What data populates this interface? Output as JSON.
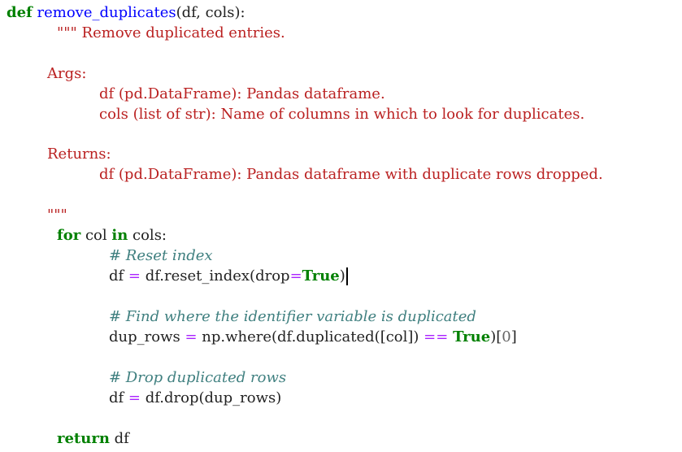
{
  "code": {
    "def_kw": "def",
    "func_name": "remove_duplicates",
    "signature": "(df, cols):",
    "doc_open": "\"\"\" Remove duplicated entries.",
    "args_header": "Args:",
    "arg_df": "df (pd.DataFrame): Pandas dataframe.",
    "arg_cols": "cols (list of str): Name of columns in which to look for duplicates.",
    "returns_header": "Returns:",
    "ret_df": "df (pd.DataFrame): Pandas dataframe with duplicate rows dropped.",
    "doc_close": "\"\"\"",
    "for_kw": "for",
    "for_var": " col ",
    "in_kw": "in",
    "for_iter": " cols:",
    "comment_reset": "# Reset index",
    "reset_lhs": "df ",
    "reset_eq": "=",
    "reset_rhs": " df.reset_index(drop",
    "reset_eq2": "=",
    "true1": "True",
    "reset_close": ")",
    "comment_find": "# Find where the identifier variable is duplicated",
    "dup_lhs": "dup_rows ",
    "dup_eq": "=",
    "dup_rhs": " np.where(df.duplicated([col]) ",
    "dup_cmp": "==",
    "true2": "True",
    "dup_close": ")[",
    "dup_idx": "0",
    "dup_end": "]",
    "comment_drop": "# Drop duplicated rows",
    "drop_lhs": "df ",
    "drop_eq": "=",
    "drop_rhs": " df.drop(dup_rows)",
    "return_kw": "return",
    "return_val": " df"
  }
}
